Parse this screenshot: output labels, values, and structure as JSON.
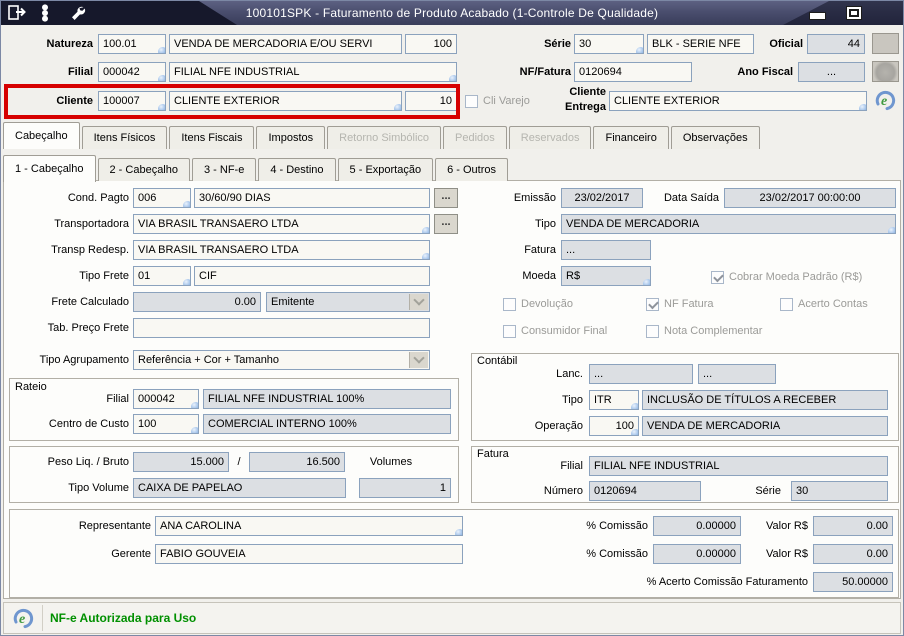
{
  "titlebar": {
    "title": "100101SPK - Faturamento de Produto Acabado (1-Controle De Qualidade)"
  },
  "header": {
    "natureza": {
      "label": "Natureza",
      "code": "100.01",
      "desc": "VENDA DE MERCADORIA E/OU SERVI",
      "tipo": "100"
    },
    "serie": {
      "label": "Série",
      "code": "30",
      "desc": "BLK - SERIE NFE"
    },
    "oficial": {
      "label": "Oficial",
      "value": "44"
    },
    "filial": {
      "label": "Filial",
      "code": "000042",
      "desc": "FILIAL NFE INDUSTRIAL"
    },
    "nf_fatura": {
      "label": "NF/Fatura",
      "value": "0120694"
    },
    "ano_fiscal": {
      "label": "Ano Fiscal",
      "value": "..."
    },
    "cliente": {
      "label": "Cliente",
      "code": "100007",
      "desc": "CLIENTE EXTERIOR",
      "loja": "10"
    },
    "cli_varejo": {
      "label": "Cli Varejo",
      "checked": false
    },
    "cliente_entrega": {
      "label": "Cliente Entrega",
      "value": "CLIENTE EXTERIOR"
    }
  },
  "tabs": {
    "main": [
      {
        "label": "Cabeçalho",
        "active": true,
        "disabled": false
      },
      {
        "label": "Itens Físicos",
        "active": false,
        "disabled": false
      },
      {
        "label": "Itens Fiscais",
        "active": false,
        "disabled": false
      },
      {
        "label": "Impostos",
        "active": false,
        "disabled": false
      },
      {
        "label": "Retorno Simbólico",
        "active": false,
        "disabled": true
      },
      {
        "label": "Pedidos",
        "active": false,
        "disabled": true
      },
      {
        "label": "Reservados",
        "active": false,
        "disabled": true
      },
      {
        "label": "Financeiro",
        "active": false,
        "disabled": false
      },
      {
        "label": "Observações",
        "active": false,
        "disabled": false
      }
    ],
    "sub": [
      {
        "label": "1 - Cabeçalho",
        "active": true
      },
      {
        "label": "2 - Cabeçalho",
        "active": false
      },
      {
        "label": "3 - NF-e",
        "active": false
      },
      {
        "label": "4 - Destino",
        "active": false
      },
      {
        "label": "5 - Exportação",
        "active": false
      },
      {
        "label": "6 - Outros",
        "active": false
      }
    ]
  },
  "form": {
    "cond_pagto": {
      "label": "Cond. Pagto",
      "code": "006",
      "desc": "30/60/90 DIAS"
    },
    "transportadora": {
      "label": "Transportadora",
      "value": "VIA BRASIL TRANSAERO LTDA"
    },
    "transp_redesp": {
      "label": "Transp Redesp.",
      "value": "VIA BRASIL TRANSAERO LTDA"
    },
    "tipo_frete": {
      "label": "Tipo Frete",
      "code": "01",
      "desc": "CIF"
    },
    "frete_calculado": {
      "label": "Frete Calculado",
      "value": "0.00",
      "origem": "Emitente"
    },
    "tab_preco_frete": {
      "label": "Tab. Preço Frete",
      "value": ""
    },
    "tipo_agrupamento": {
      "label": "Tipo Agrupamento",
      "value": "Referência + Cor + Tamanho"
    },
    "emissao": {
      "label": "Emissão",
      "value": "23/02/2017"
    },
    "data_saida": {
      "label": "Data Saída",
      "value": "23/02/2017 00:00:00"
    },
    "tipo": {
      "label": "Tipo",
      "value": "VENDA DE MERCADORIA"
    },
    "fatura": {
      "label": "Fatura",
      "value": "..."
    },
    "moeda": {
      "label": "Moeda",
      "value": "R$"
    },
    "checks": {
      "cobrar_moeda": {
        "label": "Cobrar Moeda Padrão (R$)",
        "checked": true
      },
      "devolucao": {
        "label": "Devolução",
        "checked": false
      },
      "nf_fatura": {
        "label": "NF Fatura",
        "checked": true
      },
      "acerto_contas": {
        "label": "Acerto Contas",
        "checked": false
      },
      "consumidor_final": {
        "label": "Consumidor Final",
        "checked": false
      },
      "nota_complementar": {
        "label": "Nota Complementar",
        "checked": false
      }
    },
    "rateio": {
      "caption": "Rateio",
      "filial": {
        "label": "Filial",
        "code": "000042",
        "desc": "FILIAL NFE INDUSTRIAL 100%"
      },
      "centro_custo": {
        "label": "Centro de Custo",
        "code": "100",
        "desc": "COMERCIAL INTERNO 100%"
      }
    },
    "peso": {
      "label": "Peso Liq. / Bruto",
      "liquido": "15.000",
      "separador": "/",
      "bruto": "16.500",
      "volumes_label": "Volumes",
      "tipo_volume": {
        "label": "Tipo Volume",
        "value": "CAIXA DE PAPELAO"
      },
      "volumes_qtd": "1"
    },
    "contabil": {
      "caption": "Contábil",
      "lanc": {
        "label": "Lanc.",
        "v1": "...",
        "v2": "..."
      },
      "tipo": {
        "label": "Tipo",
        "code": "ITR",
        "desc": "INCLUSÃO DE TÍTULOS A RECEBER"
      },
      "operacao": {
        "label": "Operação",
        "code": "100",
        "desc": "VENDA DE MERCADORIA"
      }
    },
    "fatura_grupo": {
      "caption": "Fatura",
      "filial": {
        "label": "Filial",
        "value": "FILIAL NFE INDUSTRIAL"
      },
      "numero": {
        "label": "Número",
        "value": "0120694"
      },
      "serie": {
        "label": "Série",
        "value": "30"
      }
    },
    "comissoes": {
      "representante": {
        "label": "Representante",
        "value": "ANA CAROLINA",
        "pct_label": "% Comissão",
        "pct": "0.00000",
        "valor_label": "Valor R$",
        "valor": "0.00"
      },
      "gerente": {
        "label": "Gerente",
        "value": "FABIO GOUVEIA",
        "pct_label": "% Comissão",
        "pct": "0.00000",
        "valor_label": "Valor R$",
        "valor": "0.00"
      },
      "acerto": {
        "label": "% Acerto Comissão Faturamento",
        "value": "50.00000"
      }
    }
  },
  "ui": {
    "more": "..."
  },
  "status": {
    "message": "NF-e Autorizada para Uso"
  },
  "colors": {
    "highlight_red": "#d60000",
    "status_green": "#009000",
    "titlebar": "#474b6a",
    "field_border": "#8ba2bd"
  }
}
